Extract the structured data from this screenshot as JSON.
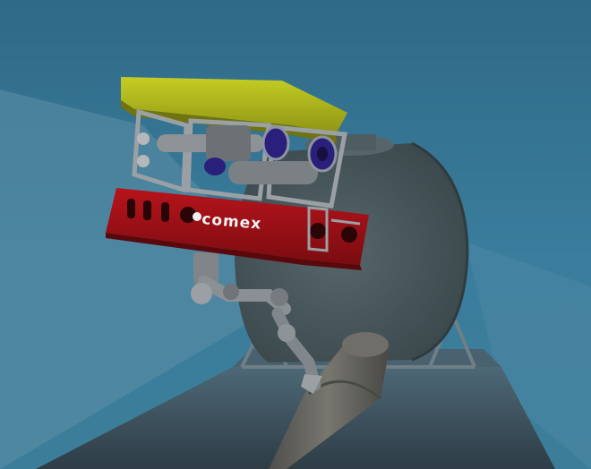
{
  "scene": {
    "type": "underwater-rov-simulation",
    "water_color": "#2e6f8e",
    "seabed_color": "#3b4a55"
  },
  "rov": {
    "brand_label": "comex",
    "top_color": "#b9c21a",
    "skid_color": "#b3121a",
    "frame_color": "#7b8086",
    "thruster_color": "#2a1f7a"
  },
  "tank": {
    "color": "#4b5a5e"
  },
  "pipe": {
    "color": "#6a6a66"
  }
}
